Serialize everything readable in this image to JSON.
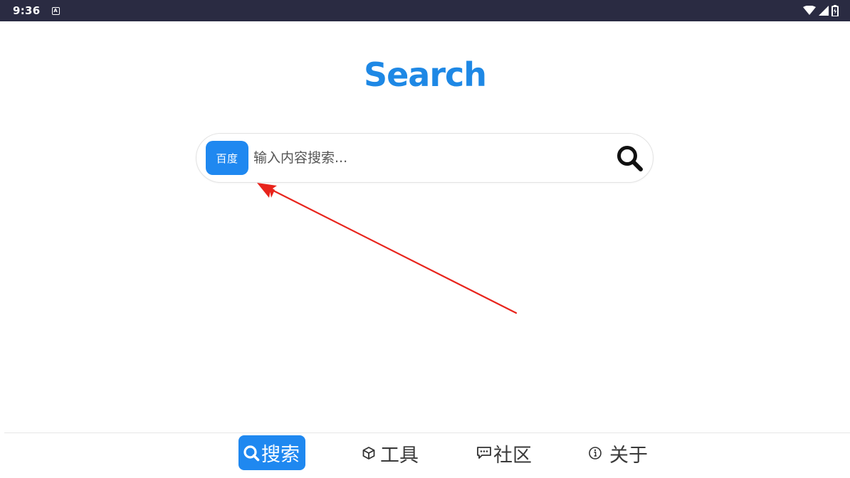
{
  "status_bar": {
    "time": "9:36",
    "notification_icon": "a-box-icon",
    "right_icons": [
      "wifi-icon",
      "signal-icon",
      "battery-icon"
    ]
  },
  "app": {
    "title": "Search",
    "title_color": "#1e88e5"
  },
  "search": {
    "engine_label": "百度",
    "placeholder": "输入内容搜索...",
    "value": "",
    "button_icon": "search-icon",
    "accent_color": "#1f88f0"
  },
  "annotation": {
    "color": "#e8241c",
    "icon": "red-arrow"
  },
  "bottom_nav": {
    "items": [
      {
        "label": "搜索",
        "icon": "search-icon",
        "active": true
      },
      {
        "label": "工具",
        "icon": "cube-icon",
        "active": false
      },
      {
        "label": "社区",
        "icon": "chat-icon",
        "active": false
      },
      {
        "label": "关于",
        "icon": "info-icon",
        "active": false
      }
    ]
  }
}
